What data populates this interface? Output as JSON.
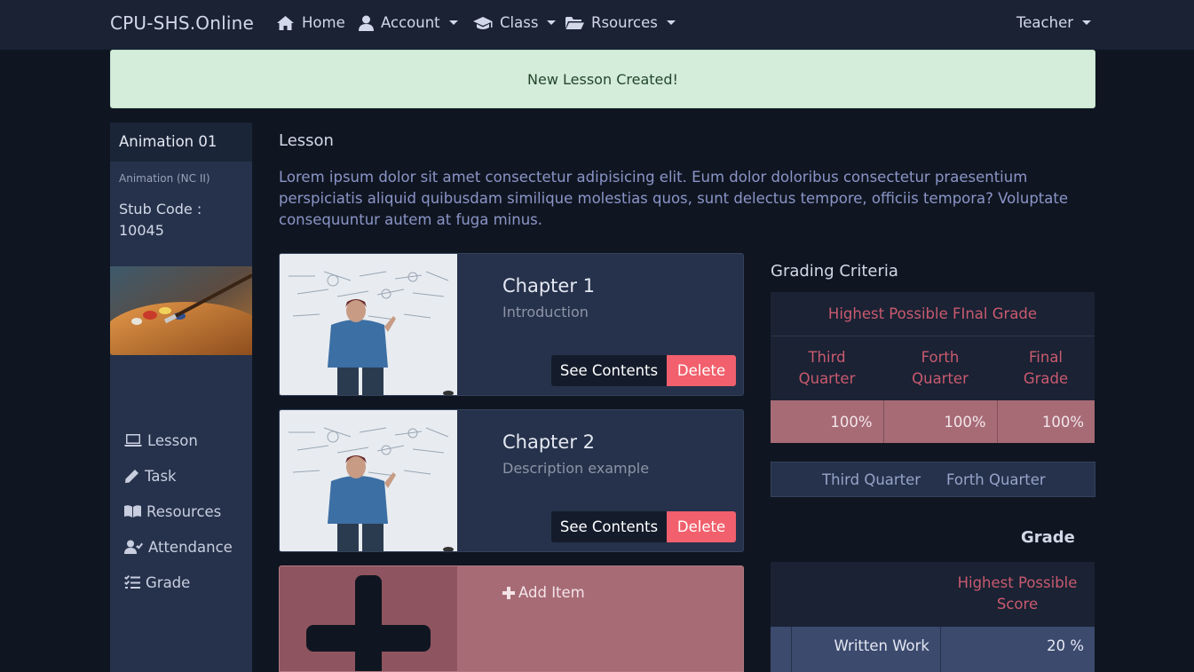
{
  "navbar": {
    "brand": "CPU-SHS.Online",
    "items": [
      {
        "label": "Home",
        "icon": "home-icon"
      },
      {
        "label": "Account",
        "icon": "user-icon"
      },
      {
        "label": "Class",
        "icon": "graduation-cap-icon"
      },
      {
        "label": "Rsources",
        "icon": "folder-open-icon"
      }
    ],
    "user_menu": "Teacher"
  },
  "alert": {
    "message": "New Lesson Created!"
  },
  "sidebar": {
    "title": "Animation 01",
    "subtitle": "Animation (NC II)",
    "stub_label": "Stub Code :",
    "stub_code": "10045",
    "menu": [
      {
        "label": "Lesson",
        "icon": "laptop-icon"
      },
      {
        "label": "Task",
        "icon": "pencil-icon"
      },
      {
        "label": "Resources",
        "icon": "book-icon"
      },
      {
        "label": "Attendance",
        "icon": "user-check-icon"
      },
      {
        "label": "Grade",
        "icon": "tasks-icon"
      }
    ]
  },
  "main": {
    "title": "Lesson",
    "description": "Lorem ipsum dolor sit amet consectetur adipisicing elit. Eum dolor doloribus consectetur praesentium perspiciatis aliquid quibusdam similique molestias quos, sunt delectus tempore, officiis tempora? Voluptate consequuntur autem at fuga minus.",
    "chapters": [
      {
        "title": "Chapter 1",
        "text": "Introduction",
        "see_label": "See Contents",
        "delete_label": "Delete"
      },
      {
        "title": "Chapter 2",
        "text": "Description example",
        "see_label": "See Contents",
        "delete_label": "Delete"
      }
    ],
    "add_item_label": "Add Item"
  },
  "grading": {
    "title": "Grading Criteria",
    "header": "Highest Possible FInal Grade",
    "columns": [
      "Third Quarter",
      "Forth Quarter",
      "Final Grade"
    ],
    "values": [
      "100%",
      "100%",
      "100%"
    ],
    "quarters": [
      "Third Quarter",
      "Forth Quarter"
    ],
    "grade_label": "Grade",
    "score_header": "Highest Possible Score",
    "rows": [
      {
        "label": "Written Work",
        "value": "20 %"
      }
    ]
  },
  "colors": {
    "navbar_bg": "#1a2234",
    "page_bg": "#101621",
    "alert_bg": "#d4ecda",
    "danger": "#f1606c",
    "accent_pink": "#a76b76"
  }
}
